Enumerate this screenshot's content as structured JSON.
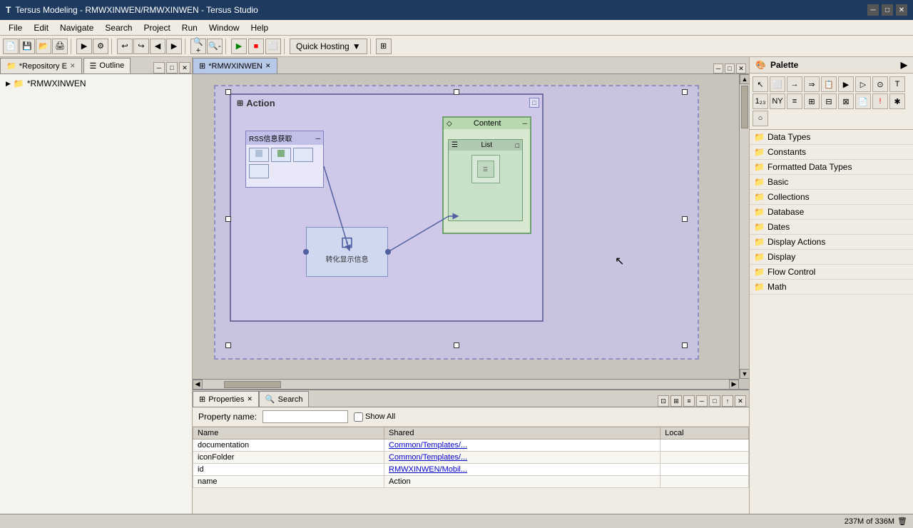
{
  "titlebar": {
    "title": "Tersus Modeling - RMWXINWEN/RMWXINWEN - Tersus Studio",
    "app_icon": "T",
    "minimize": "─",
    "maximize": "□",
    "close": "✕"
  },
  "menubar": {
    "items": [
      "File",
      "Edit",
      "Navigate",
      "Search",
      "Project",
      "Run",
      "Window",
      "Help"
    ]
  },
  "toolbar": {
    "quick_hosting": "Quick Hosting"
  },
  "left_panel": {
    "tabs": [
      {
        "label": "*Repository E",
        "active": false
      },
      {
        "label": "Outline",
        "active": false
      }
    ],
    "tree": [
      {
        "label": "*RMWXINWEN",
        "icon": "folder"
      }
    ]
  },
  "editor": {
    "tabs": [
      {
        "label": "*RMWXINWEN",
        "active": true
      }
    ]
  },
  "diagram": {
    "action_title": "Action",
    "rss_title": "RSS信息获取",
    "content_title": "Content",
    "list_title": "List",
    "transform_title": "转化显示信息"
  },
  "palette": {
    "title": "Palette",
    "categories": [
      {
        "label": "Data Types"
      },
      {
        "label": "Constants"
      },
      {
        "label": "Formatted Data Types"
      },
      {
        "label": "Basic"
      },
      {
        "label": "Collections"
      },
      {
        "label": "Database"
      },
      {
        "label": "Dates"
      },
      {
        "label": "Display Actions"
      },
      {
        "label": "Display"
      },
      {
        "label": "Flow Control"
      },
      {
        "label": "Math"
      }
    ]
  },
  "bottom_panel": {
    "tabs": [
      {
        "label": "Properties",
        "active": true
      },
      {
        "label": "Search",
        "active": false
      }
    ],
    "property_name_label": "Property name:",
    "show_all_label": "Show All",
    "table": {
      "columns": [
        "Name",
        "Shared",
        "Local"
      ],
      "rows": [
        {
          "name": "documentation",
          "shared": "Common/Templates/...",
          "local": ""
        },
        {
          "name": "iconFolder",
          "shared": "Common/Templates/...",
          "local": ""
        },
        {
          "name": "id",
          "shared": "RMWXINWEN/Mobil...",
          "local": ""
        },
        {
          "name": "name",
          "shared": "Action",
          "local": ""
        }
      ]
    }
  },
  "statusbar": {
    "memory": "237M of 336M",
    "icon": "🗑"
  }
}
